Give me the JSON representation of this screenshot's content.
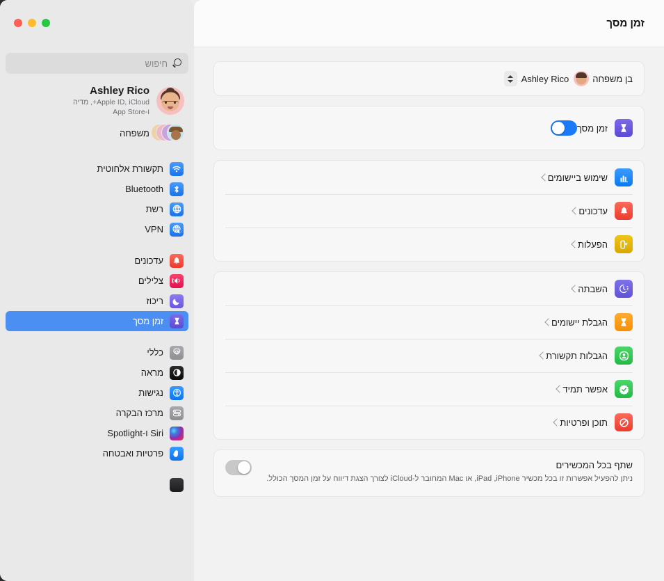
{
  "window": {
    "traffic_lights": [
      "green",
      "yellow",
      "red"
    ]
  },
  "sidebar": {
    "search": {
      "placeholder": "חיפוש",
      "value": "",
      "icon": "search-icon"
    },
    "account": {
      "name": "Ashley Rico",
      "subtitle_line1": "Apple ID, iCloud+, מדיה",
      "subtitle_line2": "ו‑App Store",
      "avatar": "memoji-avatar"
    },
    "family": {
      "label": "משפחה",
      "icon": "family-avatars-icon"
    },
    "groups": [
      {
        "items": [
          {
            "label": "תקשורת אלחוטית",
            "icon": "wifi-icon",
            "selected": false
          },
          {
            "label": "Bluetooth",
            "icon": "bluetooth-icon",
            "selected": false
          },
          {
            "label": "רשת",
            "icon": "network-globe-icon",
            "selected": false
          },
          {
            "label": "VPN",
            "icon": "vpn-globe-icon",
            "selected": false
          }
        ]
      },
      {
        "items": [
          {
            "label": "עדכונים",
            "icon": "notifications-bell-icon",
            "selected": false
          },
          {
            "label": "צלילים",
            "icon": "sound-speaker-icon",
            "selected": false
          },
          {
            "label": "ריכוז",
            "icon": "focus-moon-icon",
            "selected": false
          },
          {
            "label": "זמן מסך",
            "icon": "screen-time-hourglass-icon",
            "selected": true
          }
        ]
      },
      {
        "items": [
          {
            "label": "כללי",
            "icon": "general-gear-icon",
            "selected": false
          },
          {
            "label": "מראה",
            "icon": "appearance-contrast-icon",
            "selected": false
          },
          {
            "label": "נגישות",
            "icon": "accessibility-icon",
            "selected": false
          },
          {
            "label": "מרכז הבקרה",
            "icon": "control-center-icon",
            "selected": false
          },
          {
            "label": "Siri ו‑Spotlight",
            "icon": "siri-orb-icon",
            "selected": false
          },
          {
            "label": "פרטיות ואבטחה",
            "icon": "privacy-hand-icon",
            "selected": false
          }
        ]
      }
    ]
  },
  "main": {
    "title": "זמן מסך",
    "family_member": {
      "label": "בן משפחה",
      "selected_name": "Ashley Rico",
      "avatar": "memoji-avatar",
      "stepper": "up-down-stepper"
    },
    "screen_time": {
      "label": "זמן מסך",
      "icon": "screen-time-hourglass-icon",
      "toggle_state": "on"
    },
    "reports_group": [
      {
        "label": "שימוש ביישומים",
        "icon": "app-usage-chart-icon",
        "chevron": "chevron-left-icon"
      },
      {
        "label": "עדכונים",
        "icon": "notifications-bell-icon",
        "chevron": "chevron-left-icon"
      },
      {
        "label": "הפעלות",
        "icon": "pickups-phone-icon",
        "chevron": "chevron-left-icon"
      }
    ],
    "limits_group": [
      {
        "label": "השבתה",
        "icon": "downtime-clock-icon",
        "chevron": "chevron-left-icon"
      },
      {
        "label": "הגבלת יישומים",
        "icon": "app-limits-hourglass-icon",
        "chevron": "chevron-left-icon"
      },
      {
        "label": "הגבלות תקשורת",
        "icon": "communication-limits-person-icon",
        "chevron": "chevron-left-icon"
      },
      {
        "label": "אפשר תמיד",
        "icon": "always-allowed-check-icon",
        "chevron": "chevron-left-icon"
      },
      {
        "label": "תוכן ופרטיות",
        "icon": "content-privacy-block-icon",
        "chevron": "chevron-left-icon"
      }
    ],
    "share_across_devices": {
      "title": "שתף בכל המכשירים",
      "description": "ניתן להפעיל אפשרות זו בכל מכשיר iPhone, ‏iPad, או Mac המחובר ל‑iCloud לצורך הצגת דיווח על זמן המסך הכולל.",
      "toggle_state": "off"
    }
  }
}
